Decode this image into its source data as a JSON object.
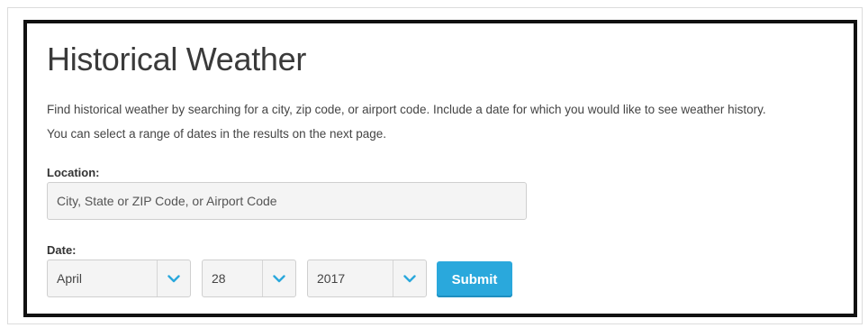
{
  "form": {
    "title": "Historical Weather",
    "description_line1": "Find historical weather by searching for a city, zip code, or airport code. Include a date for which you would like to see weather history.",
    "description_line2": "You can select a range of dates in the results on the next page.",
    "location_label": "Location:",
    "location_value": "",
    "location_placeholder": "City, State or ZIP Code, or Airport Code",
    "date_label": "Date:",
    "month_value": "April",
    "day_value": "28",
    "year_value": "2017",
    "submit_label": "Submit"
  },
  "icons": {
    "dropdown": "chevron-down-icon"
  },
  "colors": {
    "accent": "#2aa8dc",
    "chevron": "#2aa8dc",
    "panel_border": "#111111",
    "field_background": "#f4f4f4"
  }
}
